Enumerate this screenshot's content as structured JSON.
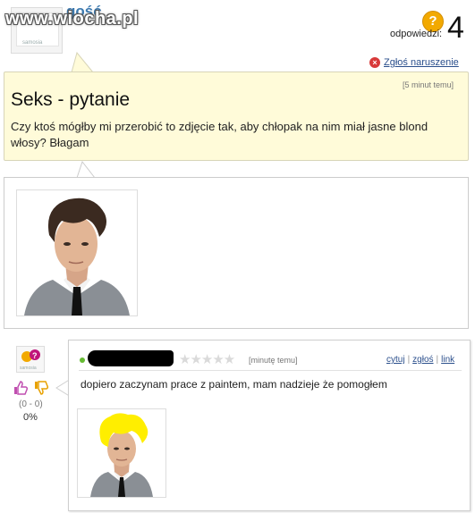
{
  "header": {
    "username": "gość",
    "watermark": "www.wiocha.pl",
    "avatar_brand": "samosia",
    "question_icon": "question-icon",
    "answers_label": "odpowiedzi:",
    "answers_count": "4",
    "report_label": "Zgłoś naruszenie"
  },
  "question": {
    "time": "[5 minut temu]",
    "title": "Seks - pytanie",
    "body": "Czy ktoś mógłby mi przerobić to zdjęcie tak, aby chłopak na nim miał jasne blond włosy? Błagam"
  },
  "answer": {
    "stars": "★★★★★",
    "time": "[minutę temu]",
    "actions": [
      "cytuj",
      "zgłoś",
      "link"
    ],
    "text": "dopiero zaczynam prace z paintem, mam nadzieje że pomogłem",
    "votes": "(0 - 0)",
    "percent": "0%"
  },
  "colors": {
    "question_bg": "#fffbd9",
    "link": "#2b4f8c",
    "accent": "#f2a900",
    "report": "#d83a3a"
  }
}
